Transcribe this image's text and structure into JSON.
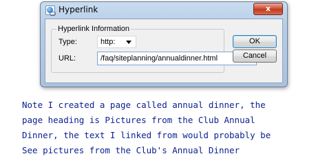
{
  "dialog": {
    "title": "Hyperlink",
    "close_symbol": "x",
    "icon": "hyperlink-globe-icon",
    "group_label": "Hyperlink Information",
    "type_label": "Type:",
    "type_value": "http:",
    "url_label": "URL:",
    "url_value": "/faq/siteplanning/annualdinner.html",
    "ok_label": "OK",
    "cancel_label": "Cancel"
  },
  "note": {
    "lines": [
      "Note I created a page called annual dinner, the",
      "page heading is Pictures from the Club Annual",
      "Dinner, the text I linked from would probably be",
      "See pictures from the Club's Annual Dinner"
    ]
  },
  "colors": {
    "note_text": "#0a1f8f",
    "close_button": "#c3391f",
    "title_bar": "#b6cde6"
  }
}
